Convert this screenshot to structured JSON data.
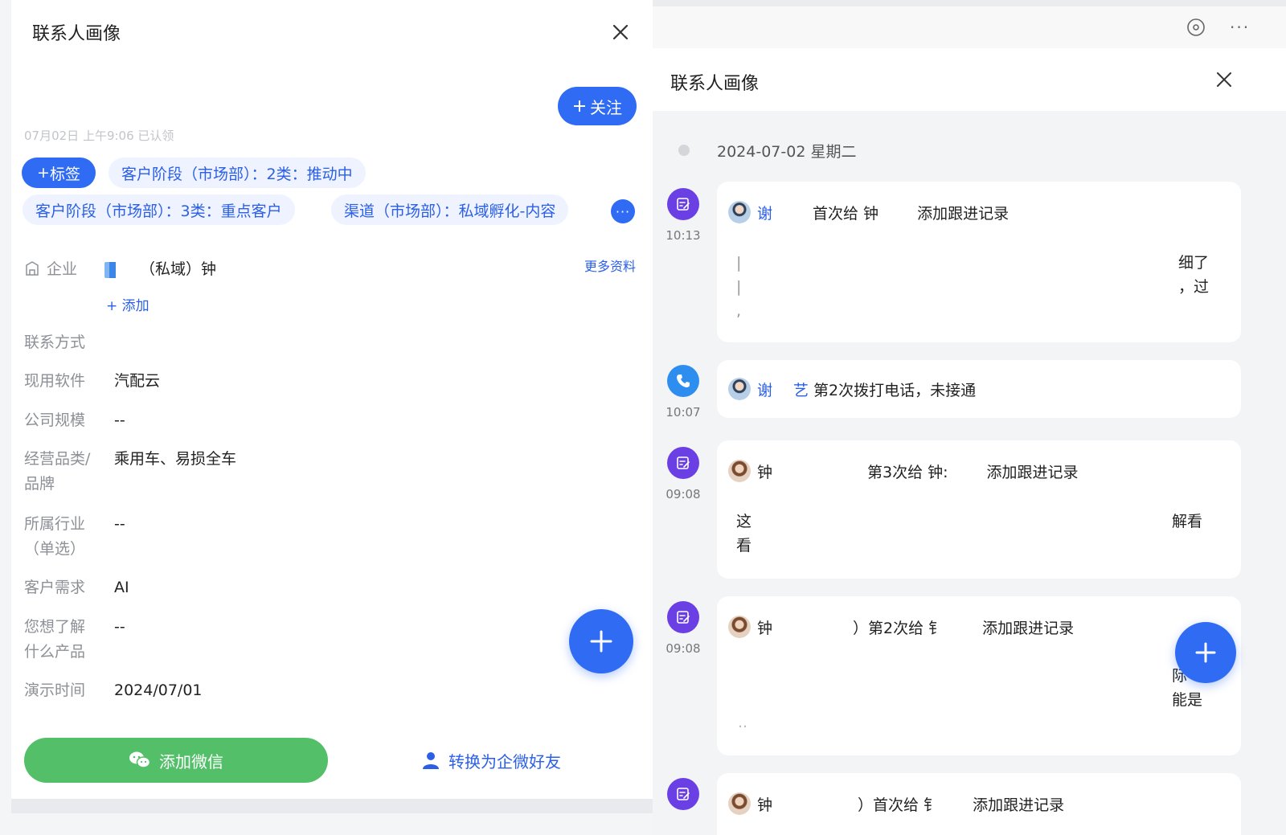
{
  "left": {
    "title": "联系人画像",
    "follow_label": "关注",
    "claim_text": "07月02日 上午9:06 已认领",
    "tag_button_label": "标签",
    "tags": [
      "客户阶段（市场部）：2类：推动中",
      "客户阶段（市场部）：3类：重点客户",
      "渠道（市场部）：私域孵化-内容"
    ],
    "more_tags_label": "···",
    "company": {
      "label": "企业",
      "name": "（私域）钟",
      "more_info": "更多资料",
      "add_label": "添加"
    },
    "fields": [
      {
        "label": "联系方式",
        "value": ""
      },
      {
        "label": "现用软件",
        "value": "汽配云"
      },
      {
        "label": "公司规模",
        "value": "--"
      },
      {
        "label": "经营品类/\n品牌",
        "value": "乘用车、易损全车"
      },
      {
        "label": "所属行业\n（单选）",
        "value": "--"
      },
      {
        "label": "客户需求",
        "value": "AI"
      },
      {
        "label": "您想了解\n什么产品",
        "value": "--"
      },
      {
        "label": "演示时间",
        "value": "2024/07/01"
      }
    ],
    "wechat_button": "添加微信",
    "convert_button": "转换为企微好友",
    "colors": {
      "primary": "#2f6bf3",
      "green": "#53c069",
      "tag_bg": "#eef3ff"
    }
  },
  "right": {
    "title": "联系人画像",
    "date_header": "2024-07-02 星期二",
    "entries": [
      {
        "type": "note",
        "time": "10:13",
        "name": "谢",
        "action": "首次给  钟",
        "record": "添加跟进记录",
        "body_left": "|\n|\n,",
        "body_right": "细了\n，过"
      },
      {
        "type": "call",
        "time": "10:07",
        "name": "谢",
        "name_suffix": "艺",
        "action": "第2次拨打电话，未接通"
      },
      {
        "type": "note",
        "time": "09:08",
        "name": "钟",
        "action": "第3次给  钟:",
        "record": "添加跟进记录",
        "body_left": "这\n看",
        "body_right": "解看"
      },
      {
        "type": "note",
        "time": "09:08",
        "name": "钟",
        "action": "）第2次给  钅",
        "record": "添加跟进记录",
        "body_left": "..",
        "body_right": "际\n能是"
      },
      {
        "type": "note",
        "time": "",
        "name": "钟",
        "action": "）首次给  钅",
        "record": "添加跟进记录"
      }
    ],
    "colors": {
      "note_icon": "#6a3fe3",
      "call_icon": "#2e8ef0"
    }
  }
}
